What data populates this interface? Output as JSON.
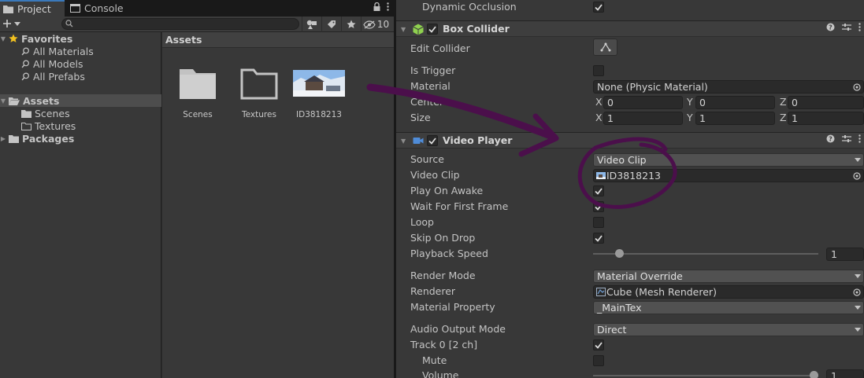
{
  "project_window": {
    "tabs": [
      {
        "label": "Project"
      },
      {
        "label": "Console"
      }
    ],
    "hidden_count": "10",
    "tree": {
      "favorites": {
        "label": "Favorites",
        "items": [
          "All Materials",
          "All Models",
          "All Prefabs"
        ]
      },
      "assets": {
        "label": "Assets",
        "children": [
          "Scenes",
          "Textures"
        ]
      },
      "packages": {
        "label": "Packages"
      }
    },
    "grid": {
      "title": "Assets",
      "items": [
        {
          "label": "Scenes",
          "icon": "folder-icon"
        },
        {
          "label": "Textures",
          "icon": "folder-outline-icon"
        },
        {
          "label": "ID3818213",
          "icon": "video-thumbnail"
        }
      ]
    }
  },
  "inspector": {
    "top_row": {
      "label": "Dynamic Occlusion",
      "checked": true
    },
    "box_collider": {
      "title": "Box Collider",
      "enabled": true,
      "edit_collider_label": "Edit Collider",
      "is_trigger": {
        "label": "Is Trigger",
        "checked": false
      },
      "material": {
        "label": "Material",
        "value": "None (Physic Material)"
      },
      "center": {
        "label": "Center",
        "x_label": "X",
        "y_label": "Y",
        "z_label": "Z",
        "x": "0",
        "y": "0",
        "z": "0"
      },
      "size": {
        "label": "Size",
        "x_label": "X",
        "y_label": "Y",
        "z_label": "Z",
        "x": "1",
        "y": "1",
        "z": "1"
      }
    },
    "video_player": {
      "title": "Video Player",
      "enabled": true,
      "source": {
        "label": "Source",
        "value": "Video Clip"
      },
      "video_clip": {
        "label": "Video Clip",
        "value": "ID3818213"
      },
      "play_on_awake": {
        "label": "Play On Awake",
        "checked": true
      },
      "wait_for_first_frame": {
        "label": "Wait For First Frame",
        "checked": true
      },
      "loop": {
        "label": "Loop",
        "checked": false
      },
      "skip_on_drop": {
        "label": "Skip On Drop",
        "checked": true
      },
      "playback_speed": {
        "label": "Playback Speed",
        "value": "1",
        "slider_fraction": 0.1
      },
      "render_mode": {
        "label": "Render Mode",
        "value": "Material Override"
      },
      "renderer": {
        "label": "Renderer",
        "value": "Cube (Mesh Renderer)"
      },
      "material_property": {
        "label": "Material Property",
        "value": "_MainTex"
      },
      "audio_output_mode": {
        "label": "Audio Output Mode",
        "value": "Direct"
      },
      "track0": {
        "label": "Track 0 [2 ch]",
        "checked": true
      },
      "mute": {
        "label": "Mute",
        "checked": false
      },
      "volume": {
        "label": "Volume",
        "value": "1",
        "slider_fraction": 1.0
      }
    }
  },
  "colors": {
    "accent_tab": "#3a79bb",
    "annotation": "#4b0f4b",
    "collider_icon": "#8fd14f",
    "video_icon": "#4f8cd8"
  }
}
